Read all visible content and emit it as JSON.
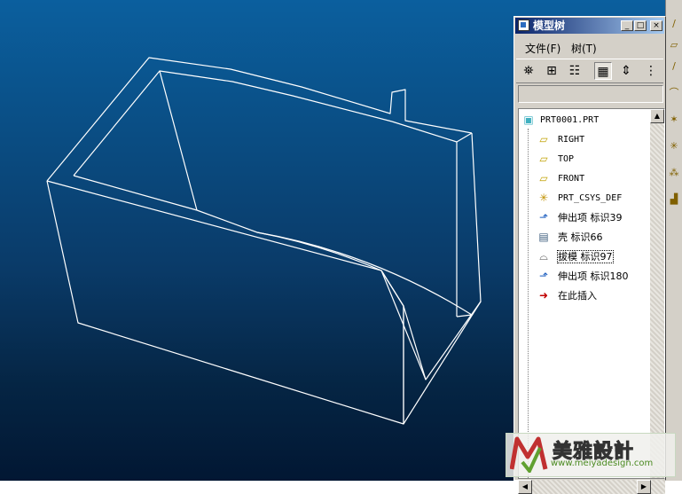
{
  "window": {
    "title": "模型树",
    "min_label": "_",
    "max_label": "□",
    "close_label": "×"
  },
  "menu": {
    "file_label": "文件(F)",
    "tree_label": "树(T)"
  },
  "toolbar": {
    "tools": [
      {
        "name": "binoculars-icon",
        "glyph": "🔍"
      },
      {
        "name": "tree-filter-icon",
        "glyph": "⊞"
      },
      {
        "name": "tree-columns-icon",
        "glyph": "☷"
      },
      {
        "name": "tree-display-icon",
        "glyph": "▦"
      },
      {
        "name": "expand-icon",
        "glyph": "⇕"
      },
      {
        "name": "settings-icon",
        "glyph": "⋮"
      }
    ]
  },
  "tree": {
    "items": [
      {
        "label": "PRT0001.PRT",
        "icon": "part-icon",
        "color": "#40b0c0"
      },
      {
        "label": "RIGHT",
        "icon": "datum-plane-icon",
        "color": "#d0c000"
      },
      {
        "label": "TOP",
        "icon": "datum-plane-icon",
        "color": "#d0c000"
      },
      {
        "label": "FRONT",
        "icon": "datum-plane-icon",
        "color": "#d0c000"
      },
      {
        "label": "PRT_CSYS_DEF",
        "icon": "csys-icon",
        "color": "#d0a000"
      },
      {
        "label": "伸出项 标识39",
        "icon": "protrusion-icon",
        "color": "#2060c0"
      },
      {
        "label": "壳 标识66",
        "icon": "shell-icon",
        "color": "#406080"
      },
      {
        "label": "拔模 标识97",
        "icon": "draft-icon",
        "color": "#404040"
      },
      {
        "label": "伸出项 标识180",
        "icon": "protrusion-icon",
        "color": "#2060c0"
      },
      {
        "label": "在此插入",
        "icon": "insert-here-icon",
        "color": "#c00000"
      }
    ]
  },
  "watermark": {
    "title": "美雅設計",
    "url": "www.meiyadesign.com"
  },
  "colors": {
    "viewport_top": "#0b5f9e",
    "viewport_bottom": "#021733",
    "wireframe": "#ffffff",
    "titlebar": "#0a246a"
  }
}
